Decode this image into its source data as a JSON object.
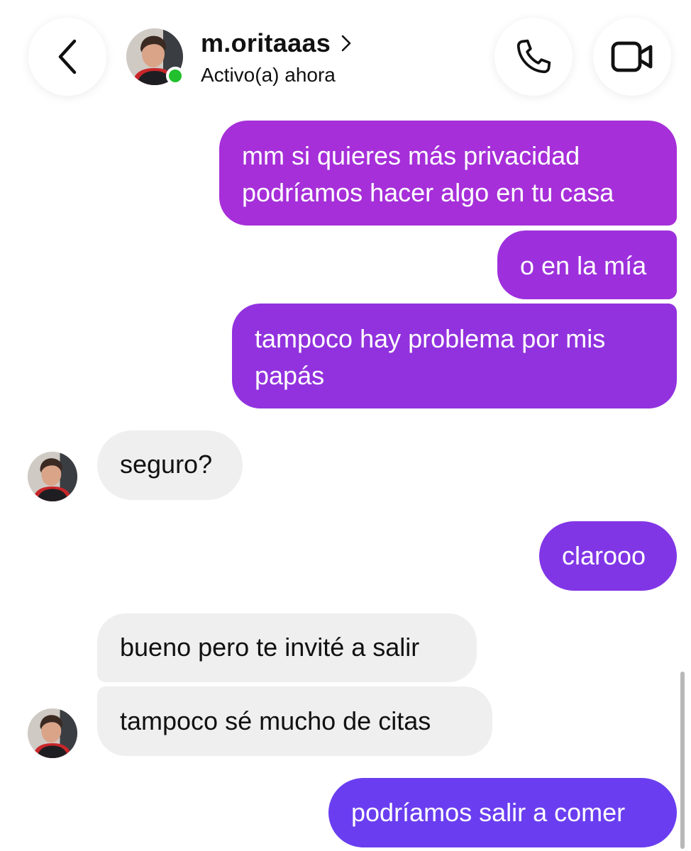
{
  "header": {
    "username": "m.oritaaas",
    "status": "Activo(a) ahora",
    "icons": {
      "back": "chevron-left-icon",
      "name_chevron": "chevron-right-icon",
      "call": "phone-icon",
      "video": "video-camera-icon"
    },
    "online_color": "#22c02e"
  },
  "messages": [
    {
      "from": "me",
      "text": "mm si quieres más privacidad podríamos hacer algo en tu casa"
    },
    {
      "from": "me",
      "text": "o en la mía"
    },
    {
      "from": "me",
      "text": "tampoco hay problema por mis papás"
    },
    {
      "from": "them",
      "text": "seguro?"
    },
    {
      "from": "me",
      "text": "clarooo"
    },
    {
      "from": "them",
      "text": "bueno pero te invité a salir"
    },
    {
      "from": "them",
      "text": "tampoco sé mucho de citas"
    },
    {
      "from": "me",
      "text": "podríamos salir a comer"
    }
  ],
  "colors": {
    "outgoing_gradient": [
      "#a62fd9",
      "#6a3ef0"
    ],
    "incoming_bubble": "#efefef"
  }
}
